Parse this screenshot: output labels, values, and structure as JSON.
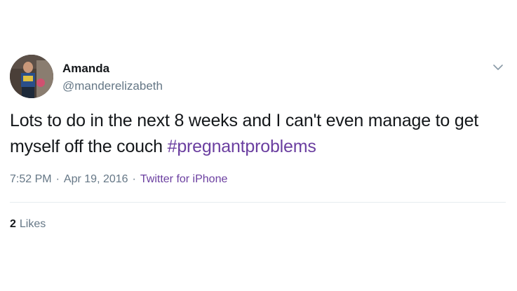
{
  "author": {
    "name": "Amanda",
    "handle": "@manderelizabeth"
  },
  "tweet": {
    "text": "Lots to do in the next 8 weeks and I can't even manage to get myself off the couch ",
    "hashtag": "#pregnantproblems"
  },
  "meta": {
    "time": "7:52 PM",
    "separator_1": "·",
    "date": "Apr 19, 2016",
    "separator_2": "·",
    "source": "Twitter for iPhone"
  },
  "stats": {
    "likes_count": "2",
    "likes_label": "Likes"
  },
  "icons": {
    "menu": "chevron-down-icon"
  },
  "colors": {
    "hashtag": "#6b3fa0",
    "secondary_text": "#657786",
    "divider": "#e6ecf0"
  }
}
